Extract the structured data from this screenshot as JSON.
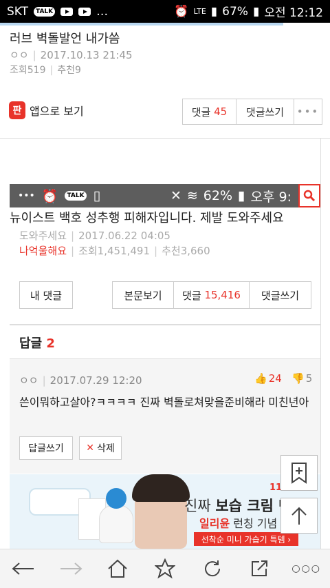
{
  "status_bar": {
    "carrier": "SKT",
    "talk_label": "TALK",
    "battery": "67%",
    "network": "LTE",
    "time": "오전 12:12"
  },
  "post": {
    "title": "러브 벽돌발언 내가씀",
    "author": "ㅇㅇ",
    "date": "2017.10.13 21:45",
    "views": "조회519",
    "recommends": "추천9"
  },
  "actions": {
    "app_view": "앱으로 보기",
    "app_logo": "판",
    "comments_label": "댓글",
    "comments_count": "45",
    "write_comment": "댓글쓰기"
  },
  "embedded": {
    "status": {
      "talk_label": "TALK",
      "battery": "62%",
      "time": "오후 9:"
    },
    "title": "뉴이스트 백호 성추행 피해자입니다. 제발 도와주세요",
    "author": "도와주세요",
    "date": "2017.06.22 04:05",
    "category": "나억울해요",
    "views": "조회1,451,491",
    "recommends": "추천3,660",
    "my_comments": "내 댓글",
    "view_body": "본문보기",
    "comments_label": "댓글",
    "comments_count": "15,416",
    "write_comment": "댓글쓰기",
    "reply_header": "답글",
    "reply_count": "2",
    "reply": {
      "author": "ㅇㅇ",
      "date": "2017.07.29 12:20",
      "likes": "24",
      "dislikes": "5",
      "text": "쓴이뭐하고살아?ㅋㅋㅋㅋ 진짜 벽돌로쳐맞을준비해라 미친년아",
      "reply_button": "답글쓰기",
      "delete_button": "삭제"
    }
  },
  "ad": {
    "brand_mark": "11",
    "line1_pre": "진짜 ",
    "line1_bold": "보습 크림",
    "line1_post": " 탄생",
    "line2_name": "일리윤",
    "line2_rest": " 런칭 기념",
    "line3": "선착순 미니 가습기 특템 ›"
  },
  "colors": {
    "accent": "#e8332a",
    "status_bar": "#000000",
    "embedded_status": "#5d5d5d"
  }
}
